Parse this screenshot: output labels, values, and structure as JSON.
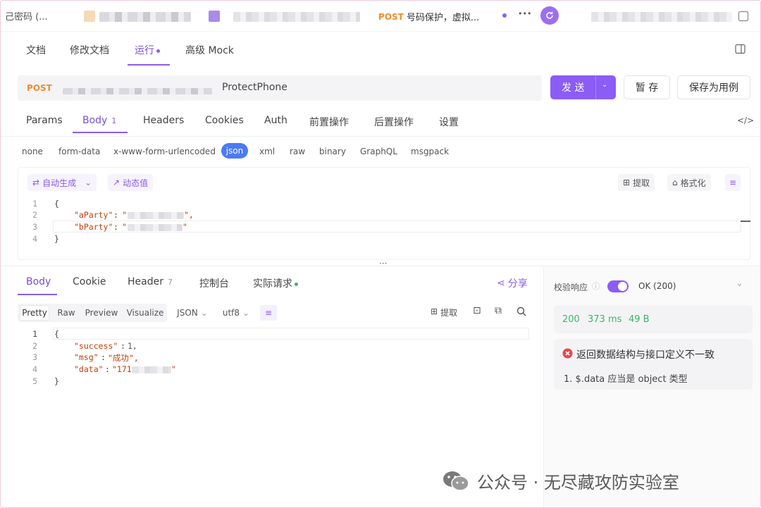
{
  "window": {
    "first_tab": "己密码 (...",
    "active_tab_method": "POST",
    "active_tab_title": "号码保护，虚拟...",
    "more": "•••"
  },
  "doc_tabs": [
    {
      "label": "文档"
    },
    {
      "label": "修改文档"
    },
    {
      "label": "运行"
    },
    {
      "label": "高级 Mock"
    }
  ],
  "request": {
    "method": "POST",
    "url_suffix": "ProtectPhone",
    "send_label": "发 送",
    "save_label": "暂 存",
    "save_case_label": "保存为用例"
  },
  "request_tabs": {
    "params": "Params",
    "body": "Body",
    "body_count": "1",
    "headers": "Headers",
    "cookies": "Cookies",
    "auth": "Auth",
    "pre": "前置操作",
    "post": "后置操作",
    "settings": "设置"
  },
  "body_types": [
    "none",
    "form-data",
    "x-www-form-urlencoded",
    "json",
    "xml",
    "raw",
    "binary",
    "GraphQL",
    "msgpack"
  ],
  "editor_toolbar": {
    "auto_gen": "自动生成",
    "dynamic": "动态值",
    "extract": "提取",
    "format": "格式化"
  },
  "request_code": {
    "line_numbers": [
      "1",
      "2",
      "3",
      "4"
    ],
    "open": "{",
    "key_a": "\"aParty\"",
    "key_b": "\"bParty\"",
    "colon": ":",
    "close": "}"
  },
  "response_tabs": {
    "body": "Body",
    "cookie": "Cookie",
    "header": "Header",
    "header_count": "7",
    "console": "控制台",
    "actual": "实际请求",
    "share": "分享"
  },
  "view_tabs": {
    "pretty": "Pretty",
    "raw": "Raw",
    "preview": "Preview",
    "visualize": "Visualize",
    "format": "JSON",
    "encoding": "utf8",
    "extract": "提取"
  },
  "response_code": {
    "line_numbers": [
      "1",
      "2",
      "3",
      "4",
      "5"
    ],
    "open": "{",
    "success_key": "\"success\"",
    "success_val": "1,",
    "msg_key": "\"msg\"",
    "msg_val": "\"成功\",",
    "data_key": "\"data\"",
    "data_val_prefix": "\"171",
    "data_val_suffix": "\"",
    "close": "}"
  },
  "validation": {
    "label": "校验响应",
    "status": "OK (200)",
    "code": "200",
    "time": "373 ms",
    "size": "49 B",
    "error_title": "返回数据结构与接口定义不一致",
    "error_item": "1. $.data 应当是 object 类型"
  },
  "watermark": "公众号 · 无尽藏攻防实验室",
  "colors": {
    "accent": "#8b5cf6",
    "method": "#f08c2a",
    "success": "#3bb56a",
    "error": "#e5484d",
    "json_pill": "#4a7bf7"
  }
}
